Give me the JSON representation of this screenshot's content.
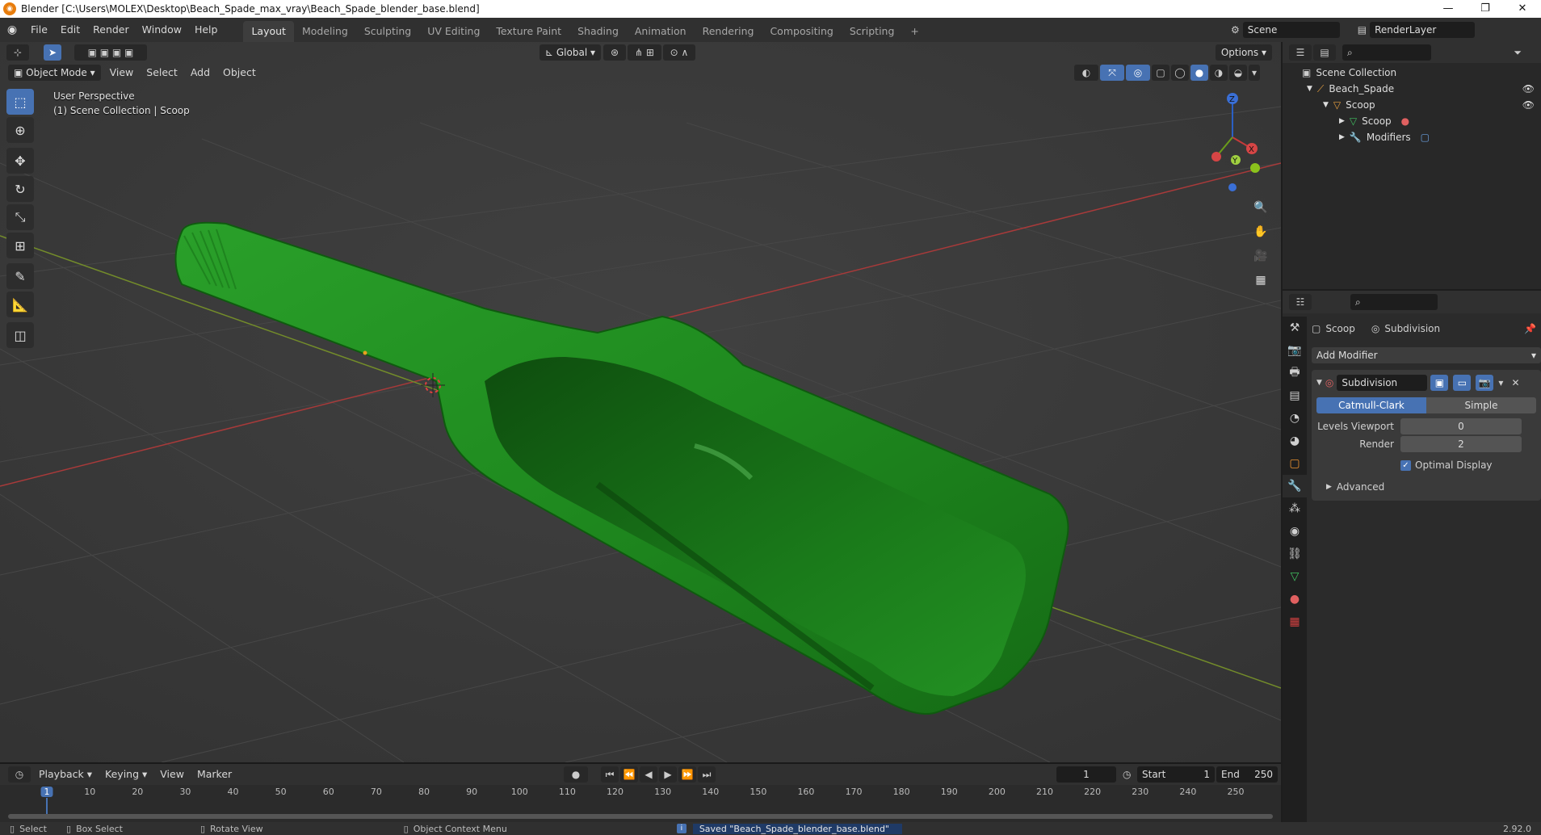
{
  "window": {
    "title": "Blender [C:\\Users\\MOLEX\\Desktop\\Beach_Spade_max_vray\\Beach_Spade_blender_base.blend]",
    "minimize": "—",
    "maximize": "❐",
    "close": "✕"
  },
  "menu": [
    "File",
    "Edit",
    "Render",
    "Window",
    "Help"
  ],
  "workspaces": [
    "Layout",
    "Modeling",
    "Sculpting",
    "UV Editing",
    "Texture Paint",
    "Shading",
    "Animation",
    "Rendering",
    "Compositing",
    "Scripting"
  ],
  "active_workspace": "Layout",
  "scene": {
    "name": "Scene",
    "view_layer": "RenderLayer"
  },
  "viewport": {
    "mode": "Object Mode",
    "menus": [
      "View",
      "Select",
      "Add",
      "Object"
    ],
    "transform_orientation": "Global",
    "options_label": "Options",
    "overlay_title": "User Perspective",
    "overlay_subtitle": "(1) Scene Collection | Scoop",
    "gizmo_labels": {
      "z": "Z",
      "y": "Y",
      "x": "X"
    },
    "colors": {
      "object": "#1f8f1f",
      "x_axis": "#b03434",
      "y_axis": "#7a9a2a",
      "accent": "#4772b3"
    }
  },
  "outliner": {
    "rows": [
      {
        "label": "Scene Collection",
        "icon": "collection-icon"
      },
      {
        "label": "Beach_Spade",
        "icon": "armature-icon"
      },
      {
        "label": "Scoop",
        "icon": "object-icon"
      },
      {
        "label": "Scoop",
        "icon": "mesh-icon"
      },
      {
        "label": "Modifiers",
        "icon": "wrench-icon"
      }
    ]
  },
  "properties": {
    "breadcrumb_object": "Scoop",
    "breadcrumb_modifier": "Subdivision",
    "add_modifier": "Add Modifier",
    "modifier": {
      "name": "Subdivision",
      "type_catmull": "Catmull-Clark",
      "type_simple": "Simple",
      "levels_viewport_label": "Levels Viewport",
      "levels_viewport": "0",
      "render_label": "Render",
      "render": "2",
      "optimal_display_label": "Optimal Display",
      "advanced_label": "Advanced"
    }
  },
  "timeline": {
    "menus": [
      "Playback",
      "Keying",
      "View",
      "Marker"
    ],
    "current_frame": "1",
    "start_label": "Start",
    "start": "1",
    "end_label": "End",
    "end": "250",
    "ticks": [
      "1",
      "10",
      "20",
      "30",
      "40",
      "50",
      "60",
      "70",
      "80",
      "90",
      "100",
      "110",
      "120",
      "130",
      "140",
      "150",
      "160",
      "170",
      "180",
      "190",
      "200",
      "210",
      "220",
      "230",
      "240",
      "250"
    ]
  },
  "statusbar": {
    "select": "Select",
    "box_select": "Box Select",
    "rotate_view": "Rotate View",
    "context_menu": "Object Context Menu",
    "message": "Saved \"Beach_Spade_blender_base.blend\"",
    "version": "2.92.0"
  }
}
